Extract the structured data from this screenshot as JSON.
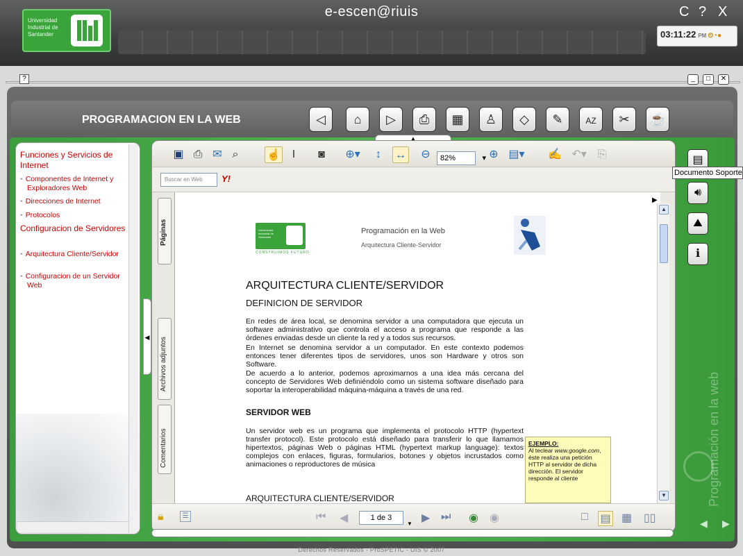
{
  "header": {
    "app_title": "e-escen@riuis",
    "logo_text": "Universidad Industrial de Santander",
    "window_controls": [
      "C",
      "?",
      "X"
    ],
    "clock": {
      "time": "03:11:22",
      "ampm": "PM"
    }
  },
  "course": {
    "title": "PROGRAMACION EN LA WEB",
    "nav_icons": [
      "back-arrow-icon",
      "home-icon",
      "forward-arrow-icon",
      "print-icon",
      "calculator-icon",
      "person-icon",
      "eraser-icon",
      "edit-icon",
      "dictionary-icon",
      "tools-icon",
      "coffee-icon"
    ]
  },
  "sidebar": {
    "sections": [
      {
        "label": "Funciones y Servicios de Internet",
        "items": [
          "Componentes de Internet y Exploradores Web",
          "Direcciones de Internet",
          "Protocolos"
        ]
      },
      {
        "label": "Configuracion de Servidores",
        "items": [
          "Arquitectura Cliente/Servidor",
          "Configuracion de un Servidor Web"
        ]
      }
    ]
  },
  "viewer": {
    "zoom": "82%",
    "search_placeholder": "Buscar en Web",
    "yahoo_label": "Y!",
    "side_tabs": [
      "Páginas",
      "Archivos adjuntos",
      "Comentarios"
    ],
    "page_indicator": "1 de 3"
  },
  "document": {
    "header_title": "Programación en la Web",
    "header_subtitle": "Arquitectura Cliente-Servidor",
    "logo_caption": "CONSTRUIMOS FUTURO",
    "logo_text": "Universidad Industrial de Santander",
    "h1": "ARQUITECTURA CLIENTE/SERVIDOR",
    "h2_definicion": "DEFINICION DE SERVIDOR",
    "p1": "En redes de área local, se denomina servidor a una computadora que ejecuta un software administrativo que controla el acceso a programa que responde a las órdenes enviadas desde un cliente la red y a todos sus recursos.",
    "p2": "En Internet se denomina servidor a un computador.  En este contexto podemos entonces tener diferentes tipos de servidores, unos son Hardware y otros son Software.",
    "p3": "De acuerdo a lo anterior, podemos aproximarnos a una idea más cercana del concepto de Servidores Web definiéndolo como un sistema software diseñado para soportar la interoperabilidad máquina-máquina a través de una red.",
    "h2_servidor": "SERVIDOR WEB",
    "p4": "Un servidor web es un programa que implementa el protocolo HTTP (hypertext transfer protocol). Este protocolo está diseñado para transferir lo que llamamos hipertextos, páginas Web o páginas HTML (hypertext markup language): textos complejos con enlaces, figuras, formularios, botones y objetos incrustados como animaciones o reproductores de música",
    "h2_arquitectura": "ARQUITECTURA CLIENTE/SERVIDOR",
    "note_title": "EJEMPLO:",
    "note_text_1": "Al teclear",
    "note_text_url": "www.google.com",
    "note_text_2": ", éste realiza una petición HTTP al servidor de dicha dirección. El servidor responde al cliente"
  },
  "right_nav": {
    "tooltip": "Documento Soporte",
    "brand_vertical": "Programación en la web"
  },
  "footer": "Derechos Reservados - ProSPETIC - UIS © 2007"
}
